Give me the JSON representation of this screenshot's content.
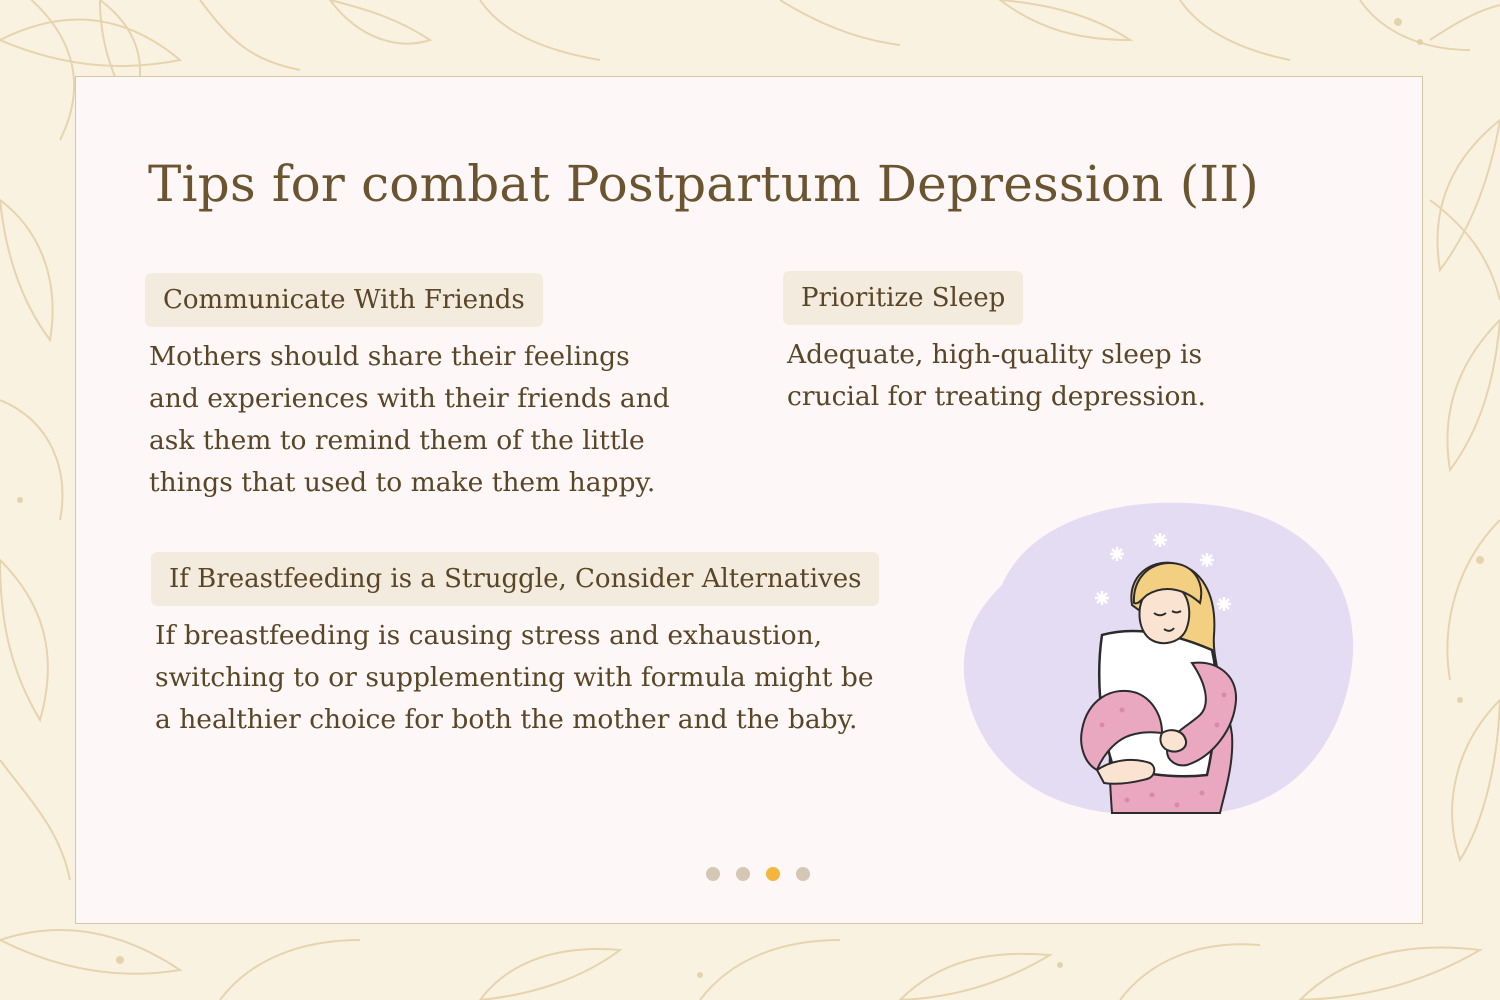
{
  "title": "Tips for combat Postpartum Depression (II)",
  "tips": [
    {
      "heading": "Communicate With Friends",
      "lines": [
        "Mothers should share their feelings",
        "and experiences with their friends and",
        "ask them to remind them of the little",
        "things that used to make them happy."
      ]
    },
    {
      "heading": "Prioritize Sleep",
      "lines": [
        "Adequate, high-quality sleep is",
        "crucial for treating depression."
      ]
    },
    {
      "heading": "If Breastfeeding is a Struggle, Consider Alternatives",
      "lines": [
        "If breastfeeding is causing stress and exhaustion,",
        "switching to or supplementing with formula might be",
        "a healthier choice for both the mother and the baby."
      ]
    }
  ],
  "pagination": {
    "total": 4,
    "active": 3
  },
  "colors": {
    "background": "#faf2e1",
    "card": "#fdf8f7",
    "title": "#6b5530",
    "tag_bg": "#f3ebdd",
    "dot": "#d4c8b5",
    "dot_active": "#f3b740",
    "illustration_bg": "#e4dcf2"
  },
  "icons": [
    "floral-background",
    "woman-hugging-pillow-illustration",
    "sparkle-icon"
  ]
}
